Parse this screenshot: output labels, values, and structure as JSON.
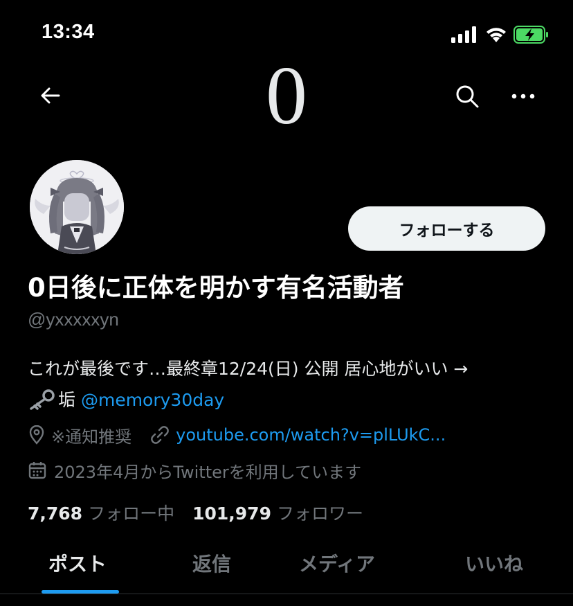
{
  "status_bar": {
    "time": "13:34",
    "icons": [
      "cellular-signal-icon",
      "wifi-icon",
      "battery-charging-icon"
    ],
    "battery_color": "#4cd964"
  },
  "header": {
    "count_text": "0",
    "icons": [
      "back-arrow-icon",
      "search-icon",
      "more-icon"
    ]
  },
  "profile": {
    "display_name": "0日後に正体を明かす有名活動者",
    "handle": "@yxxxxxyn",
    "follow_label": "フォローする",
    "bio": {
      "line1": "これが最後です…最終章12/24(日) 公開 居心地がいい →",
      "line2_text": "垢",
      "mention": "@memory30day"
    },
    "location": "※通知推奨",
    "website": "youtube.com/watch?v=plLUkC...",
    "joined": "2023年4月からTwitterを利用しています",
    "following_count": "7,768",
    "following_label": "フォロー中",
    "followers_count": "101,979",
    "followers_label": "フォロワー"
  },
  "tabs": [
    {
      "label": "ポスト",
      "active": true
    },
    {
      "label": "返信",
      "active": false
    },
    {
      "label": "メディア",
      "active": false
    },
    {
      "label": "いいね",
      "active": false
    }
  ],
  "colors": {
    "background": "#000000",
    "text_primary": "#e7e9ea",
    "text_secondary": "#71767b",
    "accent": "#1d9bf0"
  }
}
